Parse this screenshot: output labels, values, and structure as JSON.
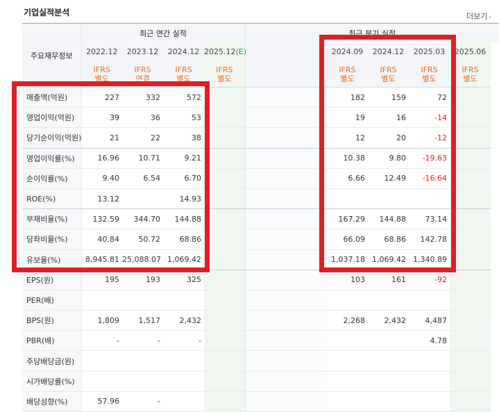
{
  "section_title": "기업실적분석",
  "more_link": "더보기",
  "header": {
    "label": "주요재무정보",
    "annual_group": "최근 연간 실적",
    "quarter_group": "최근 분기 실적",
    "annual_periods": [
      "2022.12",
      "2023.12",
      "2024.12",
      "2025.12",
      "(E)"
    ],
    "quarter_periods": [
      "2024.09",
      "2024.12",
      "2025.03",
      "2025.06"
    ],
    "annual_types": [
      [
        "IFRS",
        "별도"
      ],
      [
        "IFRS",
        "연결"
      ],
      [
        "IFRS",
        "별도"
      ],
      [
        "IFRS",
        "별도"
      ]
    ],
    "quarter_types": [
      [
        "IFRS",
        "별도"
      ],
      [
        "IFRS",
        "별도"
      ],
      [
        "IFRS",
        "별도"
      ],
      [
        "IFRS",
        "별도"
      ]
    ]
  },
  "rows": [
    {
      "label": "매출액(억원)",
      "annual": [
        "227",
        "332",
        "572",
        ""
      ],
      "quarter": [
        "182",
        "159",
        "72",
        ""
      ]
    },
    {
      "label": "영업이익(억원)",
      "annual": [
        "39",
        "36",
        "53",
        ""
      ],
      "quarter": [
        "19",
        "16",
        "-14",
        ""
      ]
    },
    {
      "label": "당기순이익(억원)",
      "annual": [
        "21",
        "22",
        "38",
        ""
      ],
      "quarter": [
        "12",
        "20",
        "-12",
        ""
      ]
    },
    {
      "label": "영업이익률(%)",
      "annual": [
        "16.96",
        "10.71",
        "9.21",
        ""
      ],
      "quarter": [
        "10.38",
        "9.80",
        "-19.63",
        ""
      ]
    },
    {
      "label": "순이익률(%)",
      "annual": [
        "9.40",
        "6.54",
        "6.70",
        ""
      ],
      "quarter": [
        "6.66",
        "12.49",
        "-16.64",
        ""
      ]
    },
    {
      "label": "ROE(%)",
      "annual": [
        "13.12",
        "",
        "14.93",
        ""
      ],
      "quarter": [
        "",
        "",
        "",
        ""
      ]
    },
    {
      "label": "부채비율(%)",
      "annual": [
        "132.59",
        "344.70",
        "144.88",
        ""
      ],
      "quarter": [
        "167.29",
        "144.88",
        "73.14",
        ""
      ]
    },
    {
      "label": "당좌비율(%)",
      "annual": [
        "40.84",
        "50.72",
        "68.86",
        ""
      ],
      "quarter": [
        "66.09",
        "68.86",
        "142.78",
        ""
      ]
    },
    {
      "label": "유보율(%)",
      "annual": [
        "8,945.81",
        "25,088.07",
        "1,069.42",
        ""
      ],
      "quarter": [
        "1,037.18",
        "1,069.42",
        "1,340.89",
        ""
      ]
    },
    {
      "label": "EPS(원)",
      "annual": [
        "195",
        "193",
        "325",
        ""
      ],
      "quarter": [
        "103",
        "161",
        "-92",
        ""
      ]
    },
    {
      "label": "PER(배)",
      "annual": [
        "",
        "",
        "",
        ""
      ],
      "quarter": [
        "",
        "",
        "",
        ""
      ]
    },
    {
      "label": "BPS(원)",
      "annual": [
        "1,809",
        "1,517",
        "2,432",
        ""
      ],
      "quarter": [
        "2,268",
        "2,432",
        "4,487",
        ""
      ]
    },
    {
      "label": "PBR(배)",
      "annual": [
        "-",
        "-",
        "-",
        ""
      ],
      "quarter": [
        "",
        "",
        "4.78",
        ""
      ]
    },
    {
      "label": "주당배당금(원)",
      "annual": [
        "",
        "",
        "",
        ""
      ],
      "quarter": [
        "",
        "",
        "",
        ""
      ]
    },
    {
      "label": "시가배당률(%)",
      "annual": [
        "",
        "",
        "",
        ""
      ],
      "quarter": [
        "",
        "",
        "",
        ""
      ]
    },
    {
      "label": "배당성향(%)",
      "annual": [
        "57.96",
        "-",
        "",
        ""
      ],
      "quarter": [
        "",
        "",
        "",
        ""
      ]
    }
  ],
  "colors": {
    "accent_orange": "#ee6a19",
    "negative": "#e02020",
    "highlight": "#e01e26",
    "estimate_green": "#3a9a3a"
  }
}
